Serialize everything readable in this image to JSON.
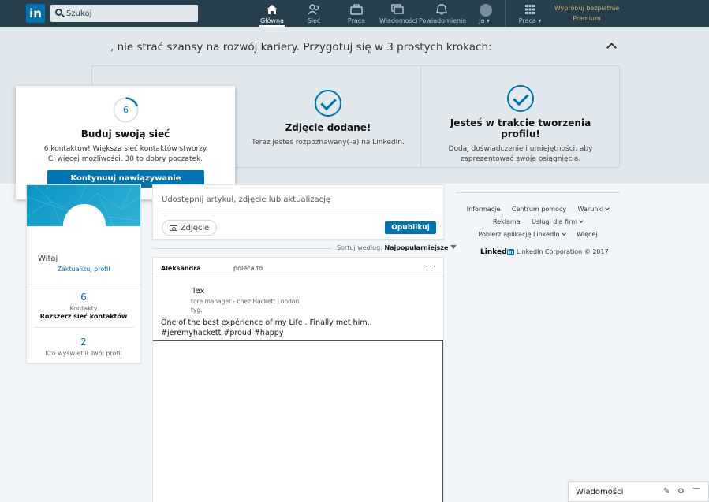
{
  "nav": {
    "logo": "in",
    "search_placeholder": "Szukaj",
    "items": [
      {
        "label": "Główna"
      },
      {
        "label": "Sieć"
      },
      {
        "label": "Praca"
      },
      {
        "label": "Wiadomości"
      },
      {
        "label": "Powiadomienia"
      },
      {
        "label": "Ja ▾"
      },
      {
        "label": "Praca ▾"
      }
    ],
    "premium_line1": "Wypróbuj bezpłatnie",
    "premium_line2": "Premium"
  },
  "onboarding": {
    "title": ", nie strać szansy na rozwój kariery. Przygotuj się w 3 prostych krokach:",
    "network": {
      "count": "6",
      "title": "Buduj swoją sieć",
      "desc": "6 kontaktów! Większa sieć kontaktów stworzy Ci więcej możliwości. 30 to dobry początek.",
      "button": "Kontynuuj nawiązywanie kontaktów",
      "progress": 0.2
    },
    "photo": {
      "title": "Zdjęcie dodane!",
      "desc": "Teraz jesteś rozpoznawany(-a) na LinkedIn."
    },
    "profile": {
      "title": "Jesteś w trakcie tworzenia profilu!",
      "desc": "Dodaj doświadczenie i umiejętności, aby zaprezentować swoje osiągnięcia."
    }
  },
  "profile_card": {
    "greeting": "Witaj",
    "update_link": "Zaktualizuj profil",
    "contacts_count": "6",
    "contacts_label": "Kontakty",
    "expand_network": "Rozszerz sieć kontaktów",
    "views_count": "2",
    "views_label": "Kto wyświetlił Twój profil"
  },
  "share": {
    "prompt": "Udostępnij artykuł, zdjęcie lub aktualizację",
    "photo_button": "Zdjęcie",
    "post_button": "Opublikuj"
  },
  "sort": {
    "label": "Sortuj według:",
    "value": "Najpopularniejsze"
  },
  "post": {
    "recommender": "Aleksandra",
    "recommends": "poleca to",
    "more": "···",
    "author_name": "'lex",
    "author_headline": "tore manager - chez Hackett London",
    "time": "tyg.",
    "body": "One of the best expérience of my Life . Finally met him.. #jeremyhackett #proud #happy"
  },
  "rail": {
    "links_row1": [
      "Informacje",
      "Centrum pomocy",
      "Warunki"
    ],
    "links_row2": [
      "Reklama",
      "Usługi dla firm"
    ],
    "links_row3": [
      "Pobierz aplikację LinkedIn",
      "Więcej"
    ],
    "brand_word": "Linked",
    "brand_in": "in",
    "copyright": "LinkedIn Corporation © 2017"
  },
  "messages": {
    "label": "Wiadomości"
  },
  "colors": {
    "nav_bg": "#283e4a",
    "brand_blue": "#0073b1",
    "band_bg": "#e1e9ee",
    "page_bg": "#f3f6f8",
    "premium_gold": "#c9b383"
  }
}
